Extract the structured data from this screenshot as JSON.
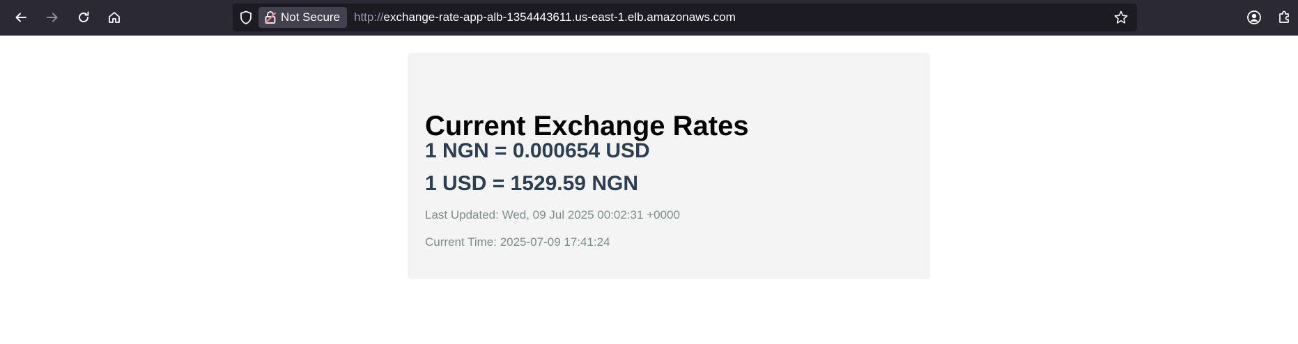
{
  "browser": {
    "toolbar": {
      "back_icon": "arrow-left-icon",
      "forward_icon": "arrow-right-icon",
      "reload_icon": "reload-icon",
      "home_icon": "home-icon"
    },
    "urlbar": {
      "security_label": "Not Secure",
      "url_protocol": "http://",
      "url_host": "exchange-rate-app-alb-1354443611.us-east-1.elb.amazonaws.com"
    },
    "colors": {
      "toolbar_bg": "#2b2a33",
      "urlbar_bg": "#1c1b22",
      "chip_bg": "#42414d",
      "insecure_lock": "#ff848b"
    }
  },
  "page": {
    "title": "Current Exchange Rates",
    "rate_ngn_usd": "1 NGN = 0.000654 USD",
    "rate_usd_ngn": "1 USD = 1529.59 NGN",
    "last_updated": "Last Updated: Wed, 09 Jul 2025 00:02:31 +0000",
    "current_time": "Current Time: 2025-07-09 17:41:24",
    "colors": {
      "card_bg": "#f4f4f4",
      "rate_text": "#2c3e50",
      "meta_text": "#7f8c8d"
    }
  }
}
